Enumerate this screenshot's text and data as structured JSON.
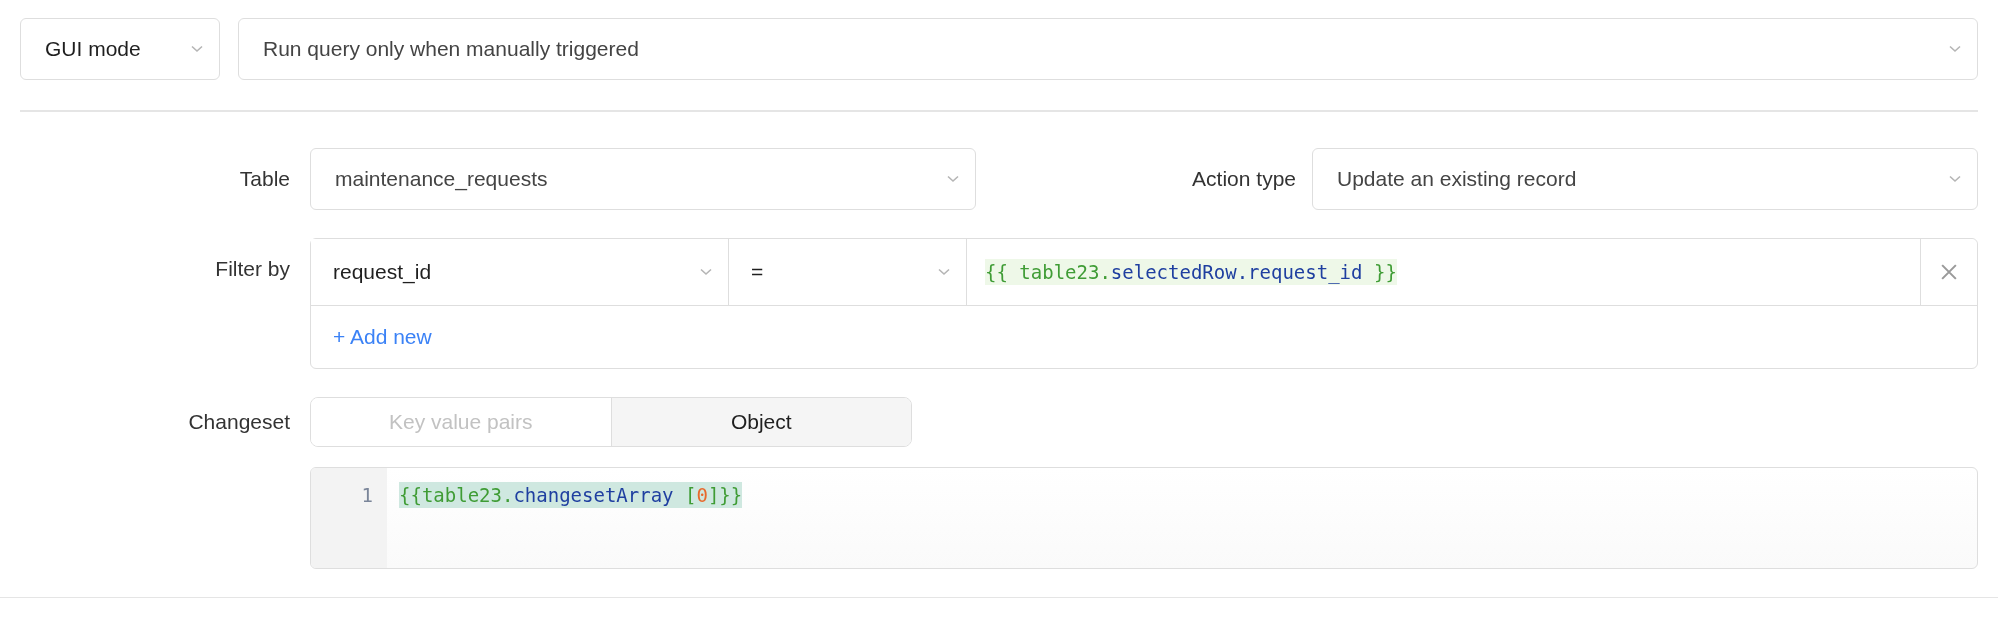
{
  "mode_select": {
    "value": "GUI mode"
  },
  "trigger_select": {
    "value": "Run query only when manually triggered"
  },
  "table_field": {
    "label": "Table",
    "value": "maintenance_requests"
  },
  "action_type_field": {
    "label": "Action type",
    "value": "Update an existing record"
  },
  "filter": {
    "label": "Filter by",
    "rows": [
      {
        "column": "request_id",
        "operator": "=",
        "value_tokens": [
          {
            "text": "{{ table23.",
            "kind": "ident"
          },
          {
            "text": "selectedRow.request_id",
            "kind": "prop"
          },
          {
            "text": " }}",
            "kind": "brace"
          }
        ]
      }
    ],
    "add_label": "+ Add new"
  },
  "changeset": {
    "label": "Changeset",
    "tabs": [
      {
        "label": "Key value pairs",
        "selected": false
      },
      {
        "label": "Object",
        "selected": true
      }
    ],
    "lines": [
      {
        "number": "1",
        "tokens": [
          {
            "text": "{{table23.",
            "kind": "ident"
          },
          {
            "text": "changesetArray",
            "kind": "prop"
          },
          {
            "text": " [",
            "kind": "brace"
          },
          {
            "text": "0",
            "kind": "number"
          },
          {
            "text": "]}}",
            "kind": "brace"
          }
        ]
      }
    ]
  }
}
